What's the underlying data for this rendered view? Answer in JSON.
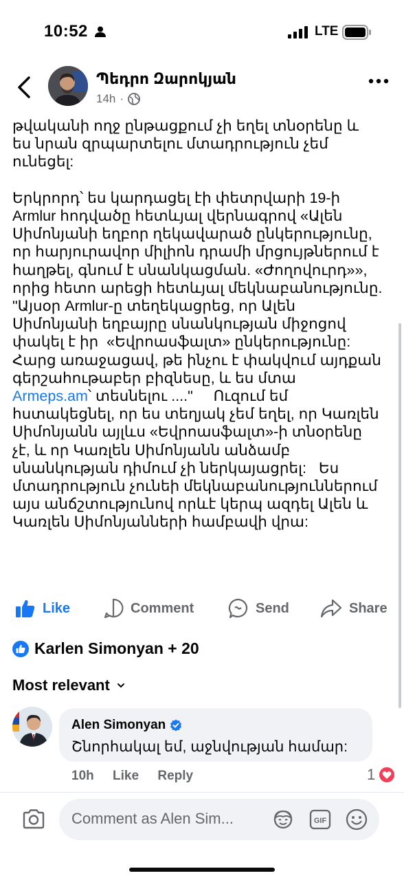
{
  "status_bar": {
    "time": "10:52",
    "network": "LTE"
  },
  "post_header": {
    "author": "Պեդրո Զարոկյան",
    "time": "14h",
    "separator": "·"
  },
  "post": {
    "text_before_link": "թվականի ողջ ընթացքում չի եղել տնօրենը և\nես նրան զրպարտելու մտադրություն չեմ\nունեցել:\n\nԵրկրորդ՝ ես կարդացել էի փետրվարի 19-ի\nArmlur հոդվածը հետևյալ վերնագրով «Ալեն\nՍիմոնյանի եղբոր ղեկավարած ընկերությունը,\nոր հարյուրավոր միլիոն դրամի մրցույթներում է\nհաղթել, գնում է սնանկացման. «Ժողովուրդ»»,\nորից հետո արեցի հետևյալ մեկնաբանությունը.\n\"Այսօր Armlur-ը տեղեկացրեց, որ Ալեն\nՍիմոնյանի եղբայրը սնանկության միջոցով\nփակել է իր  «Եվրոասֆալտ» ընկերությունը:\nՀարց առաջացավ, թե ինչու է փակվում այդքան\nգերշահութաբեր բիզնեսը, և ես մտա\n",
    "link": "Armeps.am",
    "text_after_link": "՝ տեսնելու ....\"     Ուզում եմ\nհստակեցնել, որ ես տեղյակ չեմ եղել, որ Կառլեն\nՍիմոնյանն այլևս «Եվրոասֆալտ»-ի տնօրենը\nչէ, և որ Կառլեն Սիմոնյանն անձամբ\nսնանկության դիմում չի ներկայացրել:   Ես\nմտադրություն չունեի մեկնաբանություններում\nայս անճշտությունով որևէ կերպ ազդել Ալեն և\nԿառլեն Սիմոնյանների համբավի վրա:"
  },
  "actions": {
    "like": "Like",
    "comment": "Comment",
    "send": "Send",
    "share": "Share"
  },
  "reactions": {
    "summary": "Karlen Simonyan + 20"
  },
  "sort": {
    "label": "Most relevant"
  },
  "comment": {
    "author": "Alen Simonyan",
    "text": "Շնորհակալ եմ, աջնվության համար:",
    "time": "10h",
    "like": "Like",
    "reply": "Reply",
    "reaction_count": "1"
  },
  "composer": {
    "placeholder": "Comment as Alen Sim..."
  },
  "colors": {
    "accent": "#1877f2",
    "heart": "#f33e58",
    "muted": "#65676b"
  }
}
